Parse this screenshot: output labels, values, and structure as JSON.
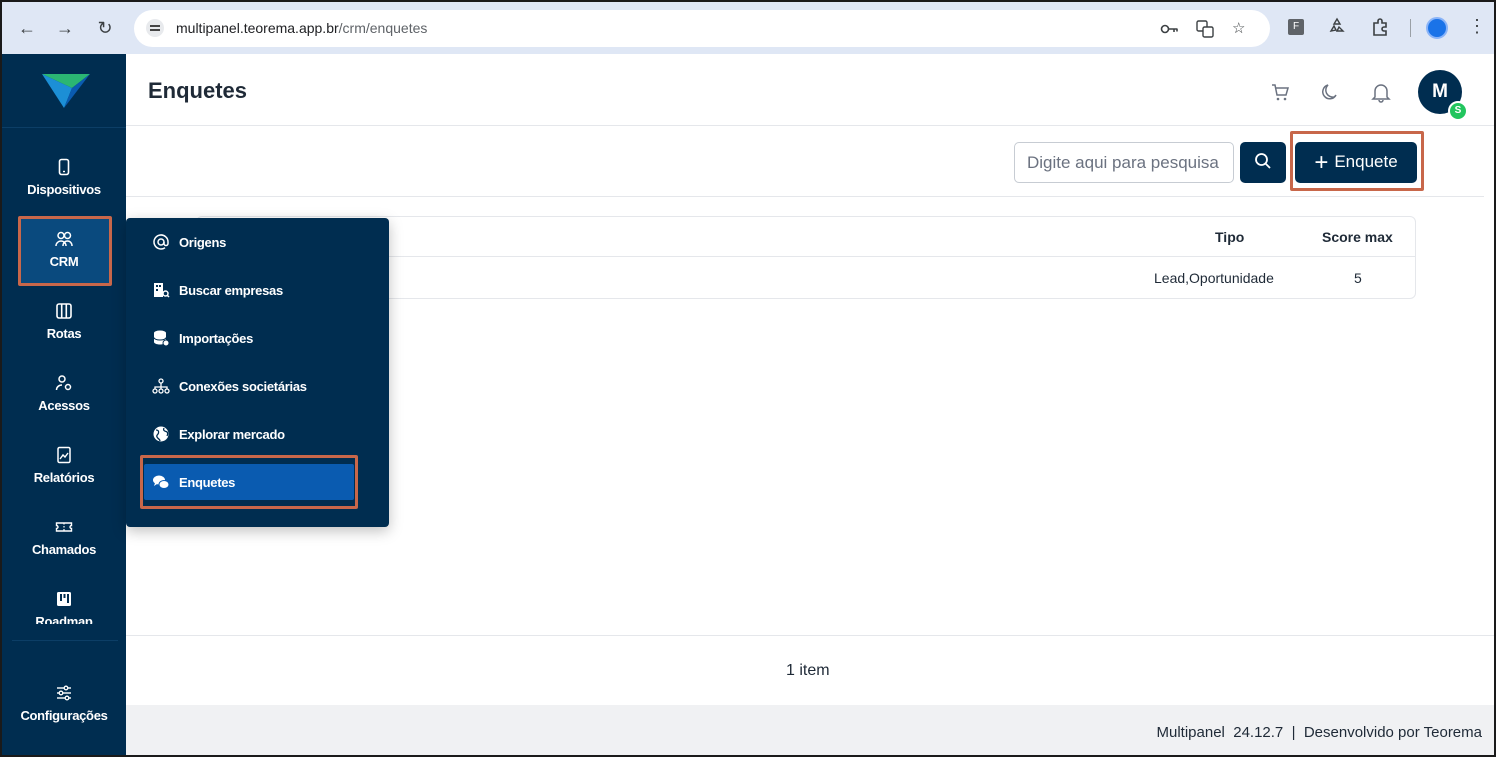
{
  "browser": {
    "url_host": "multipanel.teorema.app.br",
    "url_path": "/crm/enquetes"
  },
  "sidebar": {
    "items": [
      {
        "label": "Dispositivos",
        "icon": "phone-icon"
      },
      {
        "label": "CRM",
        "icon": "users-icon"
      },
      {
        "label": "Rotas",
        "icon": "map-icon"
      },
      {
        "label": "Acessos",
        "icon": "user-key-icon"
      },
      {
        "label": "Relatórios",
        "icon": "report-icon"
      },
      {
        "label": "Chamados",
        "icon": "ticket-icon"
      },
      {
        "label": "Roadmap",
        "icon": "roadmap-icon"
      }
    ],
    "settings_label": "Configurações"
  },
  "header": {
    "title": "Enquetes",
    "avatar_initial": "M",
    "avatar_badge": "S"
  },
  "toolbar": {
    "search_placeholder": "Digite aqui para pesquisa",
    "add_label": "Enquete"
  },
  "crm_menu": {
    "items": [
      {
        "label": "Origens",
        "icon": "at-sign-icon"
      },
      {
        "label": "Buscar empresas",
        "icon": "building-search-icon"
      },
      {
        "label": "Importações",
        "icon": "database-import-icon"
      },
      {
        "label": "Conexões societárias",
        "icon": "org-chart-icon"
      },
      {
        "label": "Explorar mercado",
        "icon": "globe-icon"
      },
      {
        "label": "Enquetes",
        "icon": "chat-bubbles-icon"
      }
    ]
  },
  "table": {
    "columns": [
      "Tipo",
      "Score max"
    ],
    "rows": [
      {
        "tipo": "Lead,Oportunidade",
        "score_max": "5"
      }
    ]
  },
  "pagination": {
    "text": "1 item"
  },
  "footer": {
    "text": "Multipanel  24.12.7  |  Desenvolvido por Teorema"
  },
  "colors": {
    "sidebar_bg": "#002d50",
    "accent_blue": "#0a5bb0",
    "highlight_border": "#c8674a",
    "badge_green": "#22c55e"
  }
}
